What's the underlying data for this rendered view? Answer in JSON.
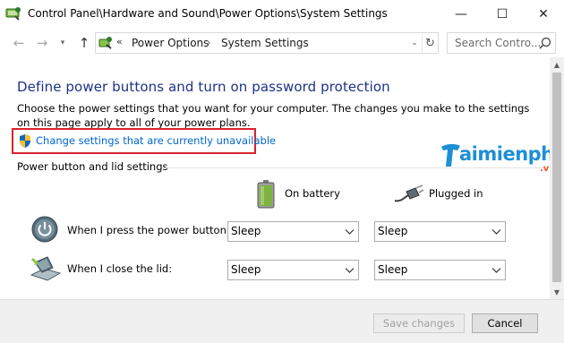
{
  "window": {
    "title": "Control Panel\\Hardware and Sound\\Power Options\\System Settings",
    "minimize_glyph": "—",
    "maximize_glyph": "☐",
    "close_glyph": "✕"
  },
  "nav": {
    "back_glyph": "←",
    "forward_glyph": "→",
    "dropdown_glyph": "▾",
    "up_glyph": "↑",
    "address": {
      "prefix": "«",
      "crumbs": [
        "Power Options",
        "System Settings"
      ],
      "separator": "›",
      "dropdown_glyph": "⌄",
      "refresh_glyph": "↻"
    },
    "search": {
      "placeholder": "Search Contro..."
    }
  },
  "main": {
    "heading": "Define power buttons and turn on password protection",
    "description": "Choose the power settings that you want for your computer. The changes you make to the settings on this page apply to all of your power plans.",
    "change_settings_link": "Change settings that are currently unavailable",
    "section_title": "Power button and lid settings",
    "columns": {
      "battery": "On battery",
      "plugged": "Plugged in"
    },
    "rows": [
      {
        "label": "When I press the power button:",
        "on_battery": "Sleep",
        "plugged_in": "Sleep"
      },
      {
        "label": "When I close the lid:",
        "on_battery": "Sleep",
        "plugged_in": "Sleep"
      }
    ]
  },
  "scrollbar": {
    "up_glyph": "▲",
    "down_glyph": "▼"
  },
  "footer": {
    "save_label": "Save changes",
    "cancel_label": "Cancel"
  },
  "watermark": {
    "brand": "aimienphi",
    "suffix": ".vn"
  },
  "colors": {
    "heading": "#1e3287",
    "link": "#0066cc",
    "highlight_border": "#d9232d",
    "footer_bg": "#f0f0f0"
  },
  "icons": {
    "title": "power-options-icon",
    "address": "control-panel-icon",
    "search": "search-icon",
    "link": "uac-shield-icon",
    "battery": "battery-icon",
    "plugged": "power-plug-icon",
    "power_button": "power-button-icon",
    "lid": "laptop-lid-icon"
  }
}
